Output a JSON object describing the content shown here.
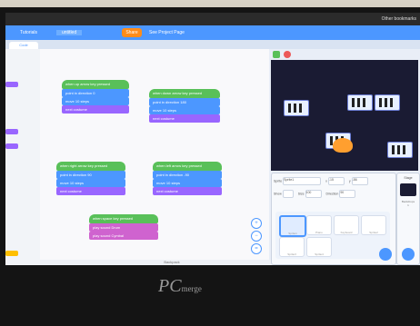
{
  "browser": {
    "bookmarks": "Other bookmarks"
  },
  "menu": {
    "tutorials": "Tutorials",
    "project_title": "untitled",
    "share": "Share",
    "see_project_page": "See Project Page"
  },
  "tabs": {
    "code": "Code"
  },
  "scripts": [
    {
      "hat": "when up arrow key pressed",
      "blocks": [
        "point in direction 0",
        "move 10 steps",
        "next costume"
      ]
    },
    {
      "hat": "when down arrow key pressed",
      "blocks": [
        "point in direction 180",
        "move 10 steps",
        "next costume"
      ]
    },
    {
      "hat": "when right arrow key pressed",
      "blocks": [
        "point in direction 90",
        "move 10 steps",
        "next costume"
      ]
    },
    {
      "hat": "when left arrow key pressed",
      "blocks": [
        "point in direction -90",
        "move 10 steps",
        "next costume"
      ]
    },
    {
      "hat": "when space key pressed",
      "blocks": [
        "play sound Drum",
        "play sound Cymbal"
      ]
    }
  ],
  "sprite_info": {
    "sprite_label": "Sprite",
    "sprite_name": "Sprite1",
    "x_label": "x",
    "x_value": "-15",
    "y_label": "y",
    "y_value": "-86",
    "show_label": "Show",
    "size_label": "Size",
    "size_value": "100",
    "direction_label": "Direction",
    "direction_value": "90"
  },
  "sprites": [
    "Sprite1",
    "Piano",
    "Keyboard",
    "Sprite2",
    "Sprite3",
    "Sprite4",
    "Sprite5"
  ],
  "stage_pane": {
    "label": "Stage",
    "backdrops_label": "Backdrops",
    "backdrops_count": "1"
  },
  "footer": {
    "backpack": "Backpack"
  },
  "laptop_brand": {
    "name": "PC",
    "suffix": "merge"
  },
  "colors": {
    "motion": "#4c97ff",
    "events": "#ffbf00",
    "looks": "#9966ff",
    "sound": "#cf63cf",
    "accent": "#4c97ff",
    "share": "#ff8c1a"
  }
}
